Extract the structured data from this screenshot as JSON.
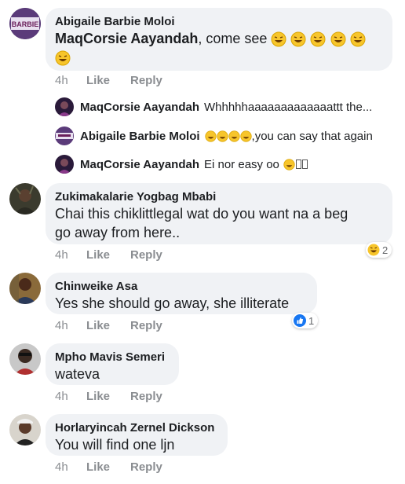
{
  "comments": [
    {
      "author": "Abigaile Barbie Moloi",
      "mention": "MaqCorsie Aayandah",
      "text": ", come see",
      "time": "4h",
      "like_label": "Like",
      "reply_label": "Reply",
      "avatar_label": "BARBIE",
      "replies": [
        {
          "author": "MaqCorsie Aayandah",
          "text": "Whhhhhaaaaaaaaaaaaattt the..."
        },
        {
          "author": "Abigaile Barbie Moloi",
          "text": ",you can say that again"
        },
        {
          "author": "MaqCorsie Aayandah",
          "text": "Ei nor easy oo"
        }
      ]
    },
    {
      "author": "Zukimakalarie Yogbag Mbabi",
      "text_line1": "Chai this chiklittlegal wat do you want na a beg",
      "text_line2": "go away from here..",
      "time": "4h",
      "like_label": "Like",
      "reply_label": "Reply",
      "reaction_count": "2"
    },
    {
      "author": "Chinweike Asa",
      "text": "Yes she should go away,  she illiterate",
      "time": "4h",
      "like_label": "Like",
      "reply_label": "Reply",
      "reaction_count": "1"
    },
    {
      "author": "Mpho Mavis Semeri",
      "text": "wateva",
      "time": "4h",
      "like_label": "Like",
      "reply_label": "Reply"
    },
    {
      "author": "Horlaryincah Zernel Dickson",
      "text": "You will find one ljn",
      "time": "4h",
      "like_label": "Like",
      "reply_label": "Reply"
    }
  ],
  "colors": {
    "bubble": "#f0f2f5",
    "meta_text": "#8a8d91",
    "like_blue": "#1877f2",
    "emoji_yellow": "#f7c52b"
  },
  "icons": [
    "laughing-emoji-icon",
    "haha-reaction-icon",
    "like-reaction-icon"
  ]
}
